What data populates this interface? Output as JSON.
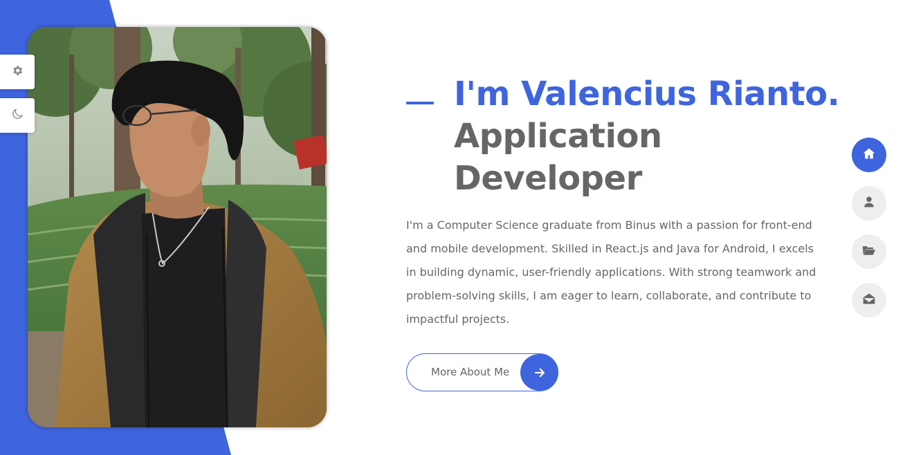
{
  "hero": {
    "headline_name": "I'm Valencius Rianto.",
    "headline_role": "Application Developer",
    "bio": "I'm a Computer Science graduate from Binus with a passion for front-end and mobile development. Skilled in React.js and Java for Android, I excels in building dynamic, user-friendly applications. With strong teamwork and problem-solving skills, I am eager to learn, collaborate, and contribute to impactful projects.",
    "cta_label": "More About Me",
    "cta_icon": "arrow-right-icon"
  },
  "settings": {
    "items": [
      {
        "name": "theme-settings",
        "icon": "gear-icon"
      },
      {
        "name": "dark-mode-toggle",
        "icon": "moon-icon"
      }
    ]
  },
  "nav": {
    "items": [
      {
        "name": "home",
        "icon": "home-icon",
        "active": true
      },
      {
        "name": "about",
        "icon": "user-icon",
        "active": false
      },
      {
        "name": "portfolio",
        "icon": "folder-open-icon",
        "active": false
      },
      {
        "name": "contact",
        "icon": "envelope-open-icon",
        "active": false
      }
    ]
  },
  "colors": {
    "accent": "#3e64de",
    "text": "#666666",
    "nav_inactive": "#eeeeee",
    "background": "#ffffff"
  }
}
